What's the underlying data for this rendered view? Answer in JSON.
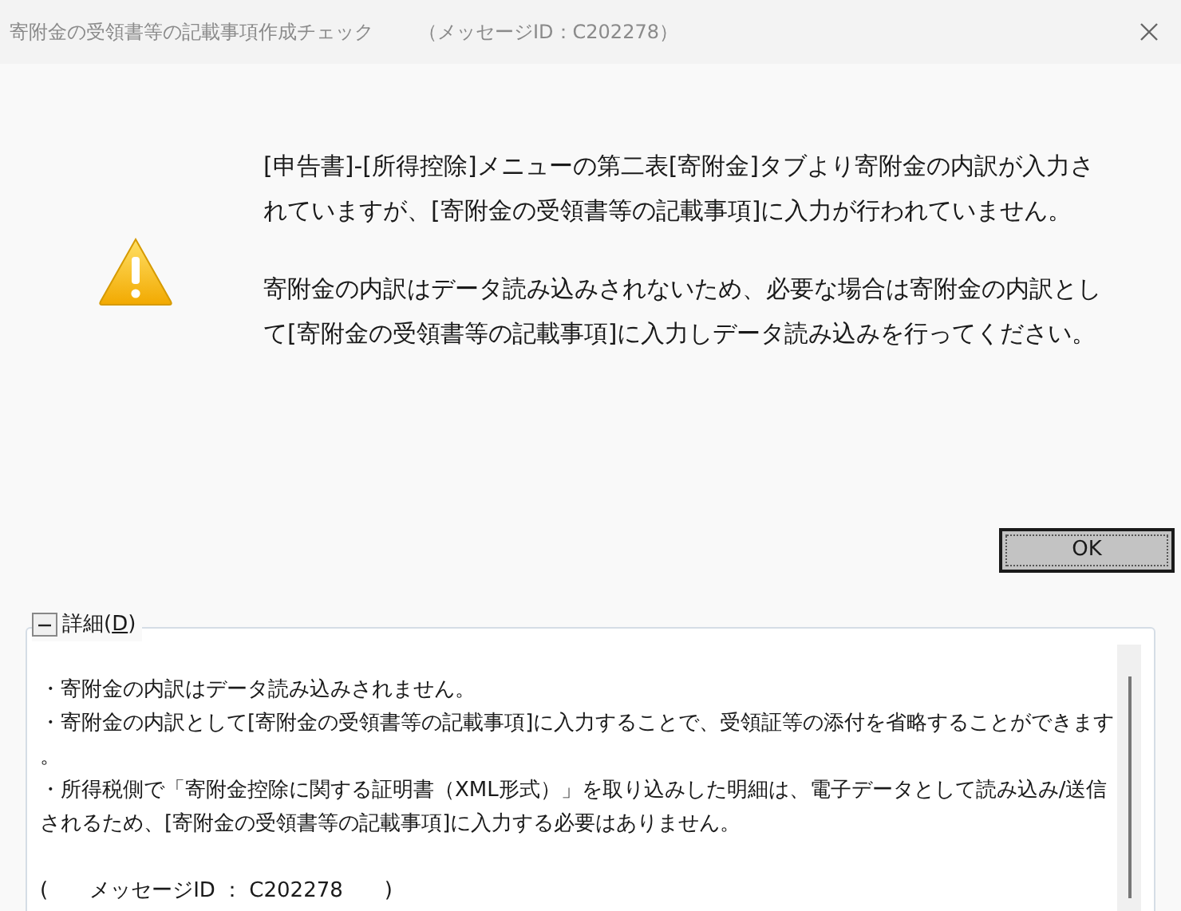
{
  "window": {
    "title": "寄附金の受領書等の記載事項作成チェック",
    "message_id": "（メッセージID：C202278）"
  },
  "message": {
    "paragraphs": [
      [
        "[申告書]-[所得控除]メニューの第二表[寄附金]タブより寄附金の内訳が入力さ",
        "れていますが、[寄附金の受領書等の記載事項]に入力が行われていません。"
      ],
      [
        "寄附金の内訳はデータ読み込みされないため、必要な場合は寄附金の内訳とし",
        "て[寄附金の受領書等の記載事項]に入力しデータ読み込みを行ってください。"
      ]
    ]
  },
  "buttons": [
    {
      "label": "OK"
    }
  ],
  "details": {
    "label": "詳細(",
    "access_key": "D",
    "label_end": ")",
    "expanded": true,
    "lines": [
      "・寄附金の内訳はデータ読み込みされません。",
      "・寄附金の内訳として[寄附金の受領書等の記載事項]に入力することで、受領証等の添付を省略することができます",
      "。",
      "・所得税側で「寄附金控除に関する証明書（XML形式）」を取り込みした明細は、電子データとして読み込み/送信",
      "されるため、[寄附金の受領書等の記載事項]に入力する必要はありません。"
    ],
    "message_id": "(　　メッセージID ： C202278　　)"
  }
}
